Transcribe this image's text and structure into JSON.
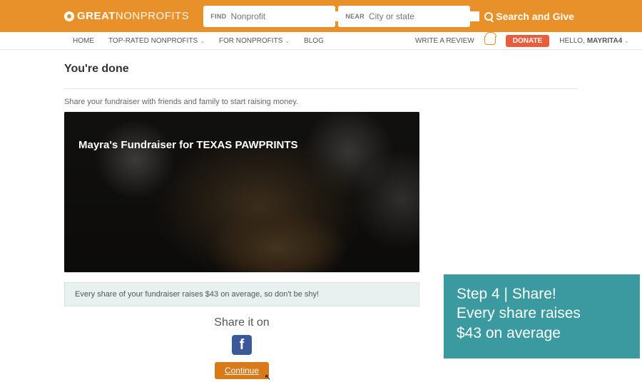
{
  "header": {
    "logo_bold": "GREAT",
    "logo_light": "NONPROFITS",
    "find_label": "FIND",
    "find_placeholder": "Nonprofit",
    "near_label": "NEAR",
    "near_placeholder": "City or state",
    "search_give": "Search and Give"
  },
  "nav": {
    "home": "HOME",
    "top_rated": "TOP-RATED NONPROFITS",
    "for_nonprofits": "FOR NONPROFITS",
    "blog": "BLOG",
    "write_review": "WRITE A REVIEW",
    "donate": "DONATE",
    "hello": "HELLO, ",
    "username": "MAYRITA4"
  },
  "main": {
    "title": "You're done",
    "subtitle": "Share your fundraiser with friends and family to start raising money.",
    "hero_title": "Mayra's Fundraiser for TEXAS PAWPRINTS",
    "share_banner": "Every share of your fundraiser raises $43 on average, so don't be shy!",
    "share_on": "Share it on",
    "fb": "f",
    "continue": "Continue"
  },
  "callout": {
    "line1": "Step 4 | Share!",
    "line2": "Every share raises",
    "line3": "$43 on average"
  }
}
